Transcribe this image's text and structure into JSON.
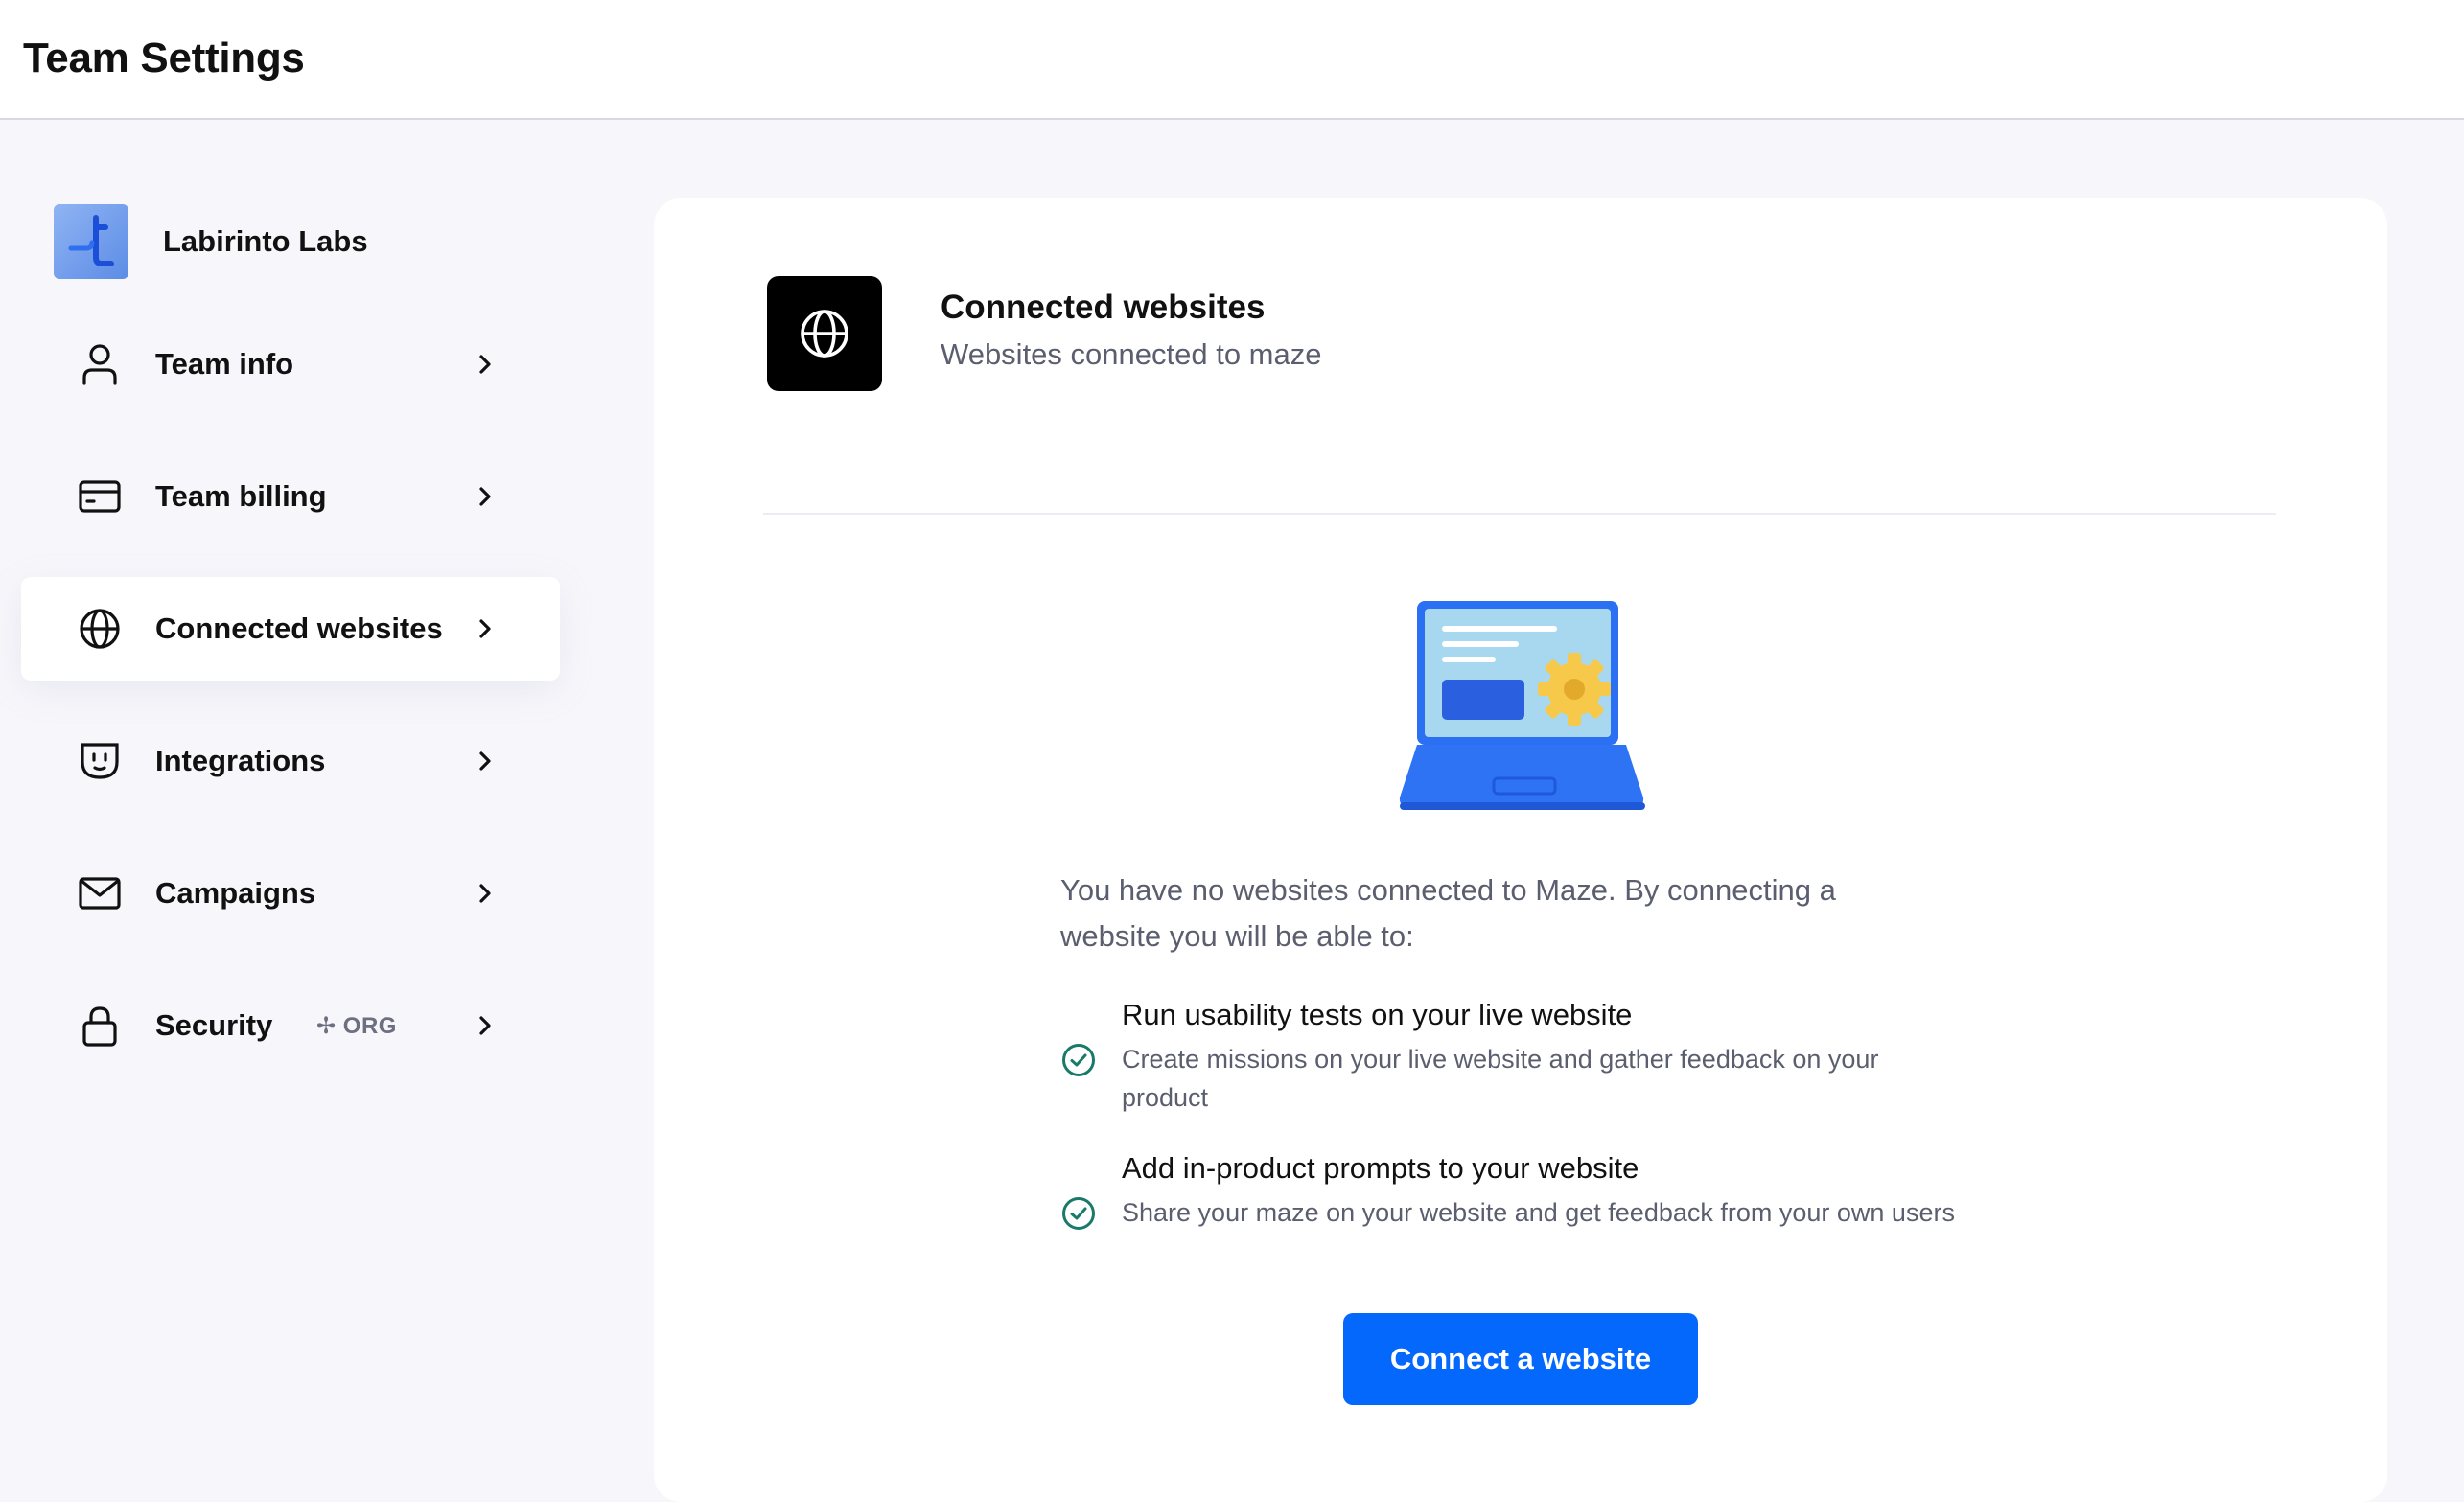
{
  "header": {
    "title": "Team Settings"
  },
  "sidebar": {
    "team": {
      "name": "Labirinto Labs",
      "logo_icon": "maze-logo-icon"
    },
    "items": [
      {
        "label": "Team info",
        "icon": "user-icon"
      },
      {
        "label": "Team billing",
        "icon": "credit-card-icon"
      },
      {
        "label": "Connected websites",
        "icon": "globe-icon",
        "active": true
      },
      {
        "label": "Integrations",
        "icon": "plug-icon"
      },
      {
        "label": "Campaigns",
        "icon": "mail-icon"
      },
      {
        "label": "Security",
        "icon": "lock-icon",
        "badge": "ORG"
      }
    ]
  },
  "main": {
    "title": "Connected websites",
    "subtitle": "Websites connected to maze",
    "header_icon": "globe-icon",
    "intro": "You have no websites connected to Maze. By connecting a website you will be able to:",
    "features": [
      {
        "title": "Run usability tests on your live website",
        "description": "Create missions on your live website and gather feedback on your product"
      },
      {
        "title": "Add in-product prompts to your website",
        "description": "Share your maze on your website and get feedback from your own users"
      }
    ],
    "cta_label": "Connect a website"
  },
  "colors": {
    "accent": "#0568fd",
    "check": "#1a7a6a",
    "background": "#f7f7fb",
    "card": "#ffffff"
  }
}
